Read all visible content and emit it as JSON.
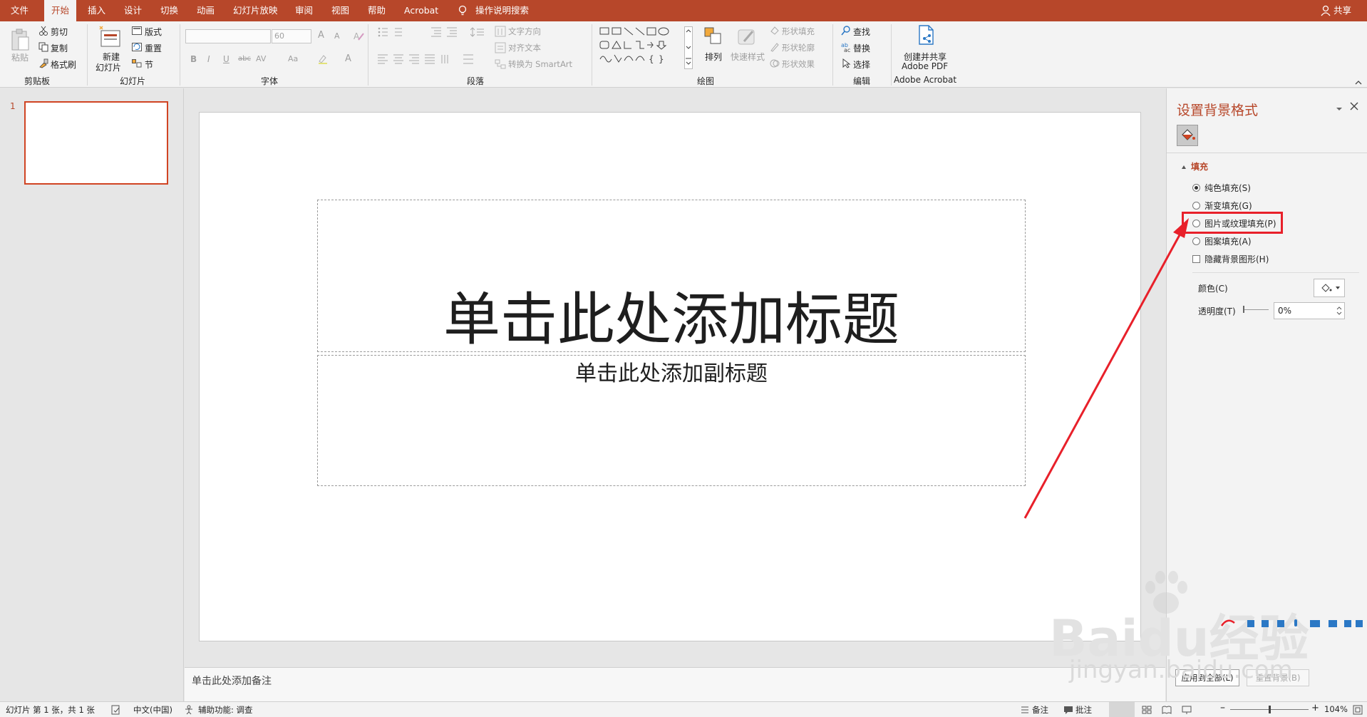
{
  "tabs": {
    "items": [
      "文件",
      "开始",
      "插入",
      "设计",
      "切换",
      "动画",
      "幻灯片放映",
      "审阅",
      "视图",
      "帮助",
      "Acrobat"
    ],
    "search": "操作说明搜索",
    "share": "共享"
  },
  "ribbon": {
    "clipboard": {
      "paste": "粘贴",
      "cut": "剪切",
      "copy": "复制",
      "format_painter": "格式刷",
      "label": "剪贴板"
    },
    "slides": {
      "new_slide_1": "新建",
      "new_slide_2": "幻灯片",
      "layout": "版式",
      "reset": "重置",
      "section": "节",
      "label": "幻灯片"
    },
    "font": {
      "size": "60",
      "bold": "B",
      "italic": "I",
      "underline": "U",
      "strike": "abc",
      "spacing": "AV",
      "case": "Aa",
      "color": "A",
      "grow": "A",
      "shrink": "A",
      "label": "字体"
    },
    "paragraph": {
      "text_direction": "文字方向",
      "align_text": "对齐文本",
      "smartart": "转换为 SmartArt",
      "label": "段落"
    },
    "drawing": {
      "arrange": "排列",
      "quick_styles": "快速样式",
      "shape_fill": "形状填充",
      "shape_outline": "形状轮廓",
      "shape_effects": "形状效果",
      "label": "绘图"
    },
    "editing": {
      "find": "查找",
      "replace": "替换",
      "select": "选择",
      "label": "编辑"
    },
    "acrobat": {
      "create_1": "创建并共享",
      "create_2": "Adobe PDF",
      "label": "Adobe Acrobat"
    }
  },
  "thumbs": {
    "slide_number": "1"
  },
  "slide": {
    "title": "单击此处添加标题",
    "subtitle": "单击此处添加副标题"
  },
  "notes": {
    "placeholder": "单击此处添加备注"
  },
  "pane": {
    "title": "设置背景格式",
    "section": "填充",
    "options": [
      "纯色填充(S)",
      "渐变填充(G)",
      "图片或纹理填充(P)",
      "图案填充(A)"
    ],
    "hide_graphics": "隐藏背景图形(H)",
    "color_label": "颜色(C)",
    "transparency_label": "透明度(T)",
    "transparency_value": "0%",
    "apply_all": "应用到全部(L)",
    "reset": "重置背景(B)"
  },
  "status": {
    "slide_info": "幻灯片 第 1 张，共 1 张",
    "language": "中文(中国)",
    "accessibility": "辅助功能: 调查",
    "notes": "备注",
    "comments": "批注",
    "zoom": "104%"
  },
  "watermark": {
    "logo": "Baidu经验",
    "url": "jingyan.baidu.com"
  },
  "colors": {
    "accent": "#b7472a",
    "highlight": "#e8202a"
  }
}
